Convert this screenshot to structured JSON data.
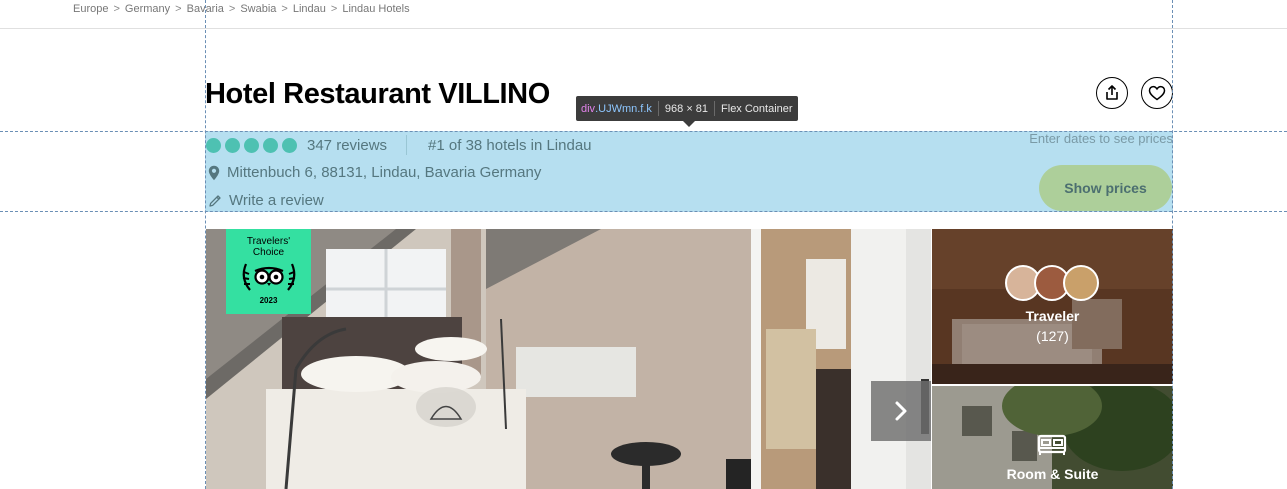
{
  "breadcrumb": [
    "Europe",
    "Germany",
    "Bavaria",
    "Swabia",
    "Lindau",
    "Lindau Hotels"
  ],
  "hotel": {
    "name": "Hotel Restaurant VILLINO",
    "rating_bubbles": 5,
    "reviews": "347 reviews",
    "rank": "#1 of 38 hotels in Lindau",
    "address": "Mittenbuch 6, 88131, Lindau, Bavaria Germany",
    "write_review": "Write a review"
  },
  "devtools_tooltip": {
    "tag": "div",
    "class_name": ".UJWmn.f.k",
    "size": "968 × 81",
    "type": "Flex Container"
  },
  "pricing": {
    "hint": "Enter dates to see prices",
    "show_prices": "Show prices"
  },
  "badge": {
    "line1": "Travelers'",
    "line2": "Choice",
    "year": "2023"
  },
  "gallery": {
    "traveler_label": "Traveler",
    "traveler_count": "(127)",
    "room_label": "Room & Suite"
  },
  "icons": {
    "share": "share-icon",
    "save": "heart-icon",
    "location": "map-pin-icon",
    "write": "pencil-icon",
    "next": "chevron-right-icon",
    "room": "bed-icon"
  },
  "colors": {
    "rating_bubble": "#4ec1b2",
    "highlight": "#b6dff0",
    "show_prices_bg": "#adcf9a",
    "travelers_choice": "#34e0a1"
  }
}
